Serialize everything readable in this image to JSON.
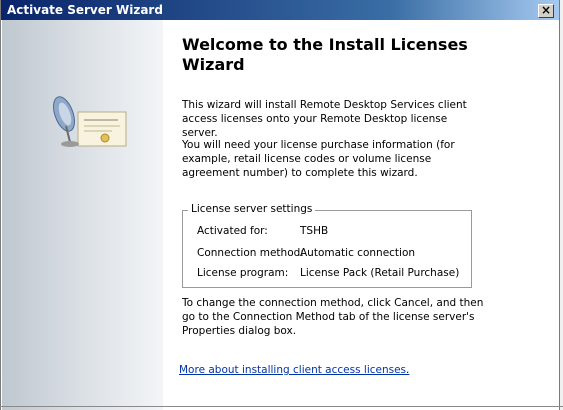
{
  "window": {
    "title": "Activate Server Wizard",
    "close_glyph": "×"
  },
  "page": {
    "heading": "Welcome to the Install Licenses Wizard",
    "intro": "This wizard will install Remote Desktop Services client access licenses onto your Remote Desktop license server.",
    "need_info": "You will need your license purchase information (for example, retail license codes or volume license agreement number) to complete this wizard.",
    "settings": {
      "legend": "License server settings",
      "rows": [
        {
          "label": "Activated for:",
          "value": "TSHB"
        },
        {
          "label": "Connection method:",
          "value": "Automatic connection"
        },
        {
          "label": "License program:",
          "value": "License Pack (Retail Purchase)"
        }
      ]
    },
    "change_info": "To change the connection method, click Cancel, and then go to the Connection Method tab of the license server's Properties dialog box.",
    "link_text": "More about installing client access licenses",
    "link_suffix": "."
  },
  "icons": {
    "illustration": "satellite-dish-certificate-icon",
    "close": "close-icon"
  },
  "colors": {
    "titlebar_start": "#0a246a",
    "titlebar_end": "#a6caf0",
    "link": "#0033aa"
  }
}
